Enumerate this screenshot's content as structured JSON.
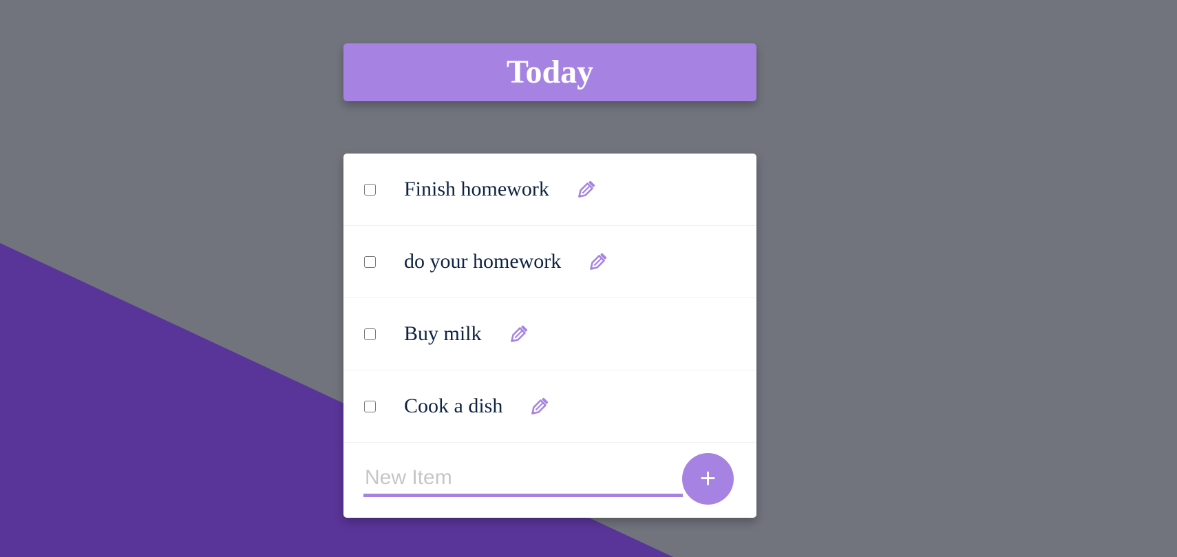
{
  "theme": {
    "background": "#71737d",
    "accent_shape": "#5a3599",
    "accent": "#a683e3",
    "text": "#0e2241"
  },
  "heading": {
    "title": "Today"
  },
  "items": [
    {
      "label": "Finish homework",
      "checked": false,
      "edit_icon": "pencil-icon"
    },
    {
      "label": "do your homework",
      "checked": false,
      "edit_icon": "pencil-icon"
    },
    {
      "label": "Buy milk",
      "checked": false,
      "edit_icon": "pencil-icon"
    },
    {
      "label": "Cook a dish",
      "checked": false,
      "edit_icon": "pencil-icon"
    }
  ],
  "new_item": {
    "placeholder": "New Item",
    "value": "",
    "add_label": "+"
  }
}
